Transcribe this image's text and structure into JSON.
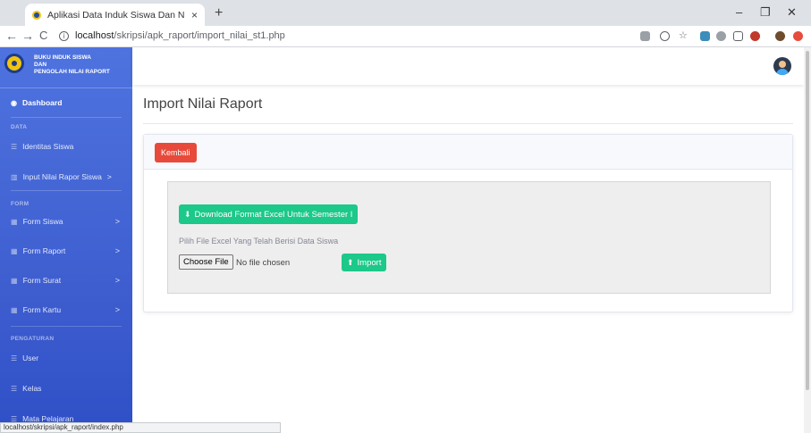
{
  "browser": {
    "tab_title": "Aplikasi Data Induk Siswa Dan N",
    "tab_close": "×",
    "new_tab": "+",
    "url_host": "localhost",
    "url_path": "/skripsi/apk_raport/import_nilai_st1.php",
    "status_url": "localhost/skripsi/apk_raport/index.php",
    "controls": {
      "minimize": "–",
      "maximize": "❐",
      "close": "✕"
    }
  },
  "sidebar": {
    "brand_lines": [
      "BUKU INDUK SISWA",
      "DAN",
      "PENGOLAH NILAI RAPORT"
    ],
    "dashboard": "Dashboard",
    "sections": {
      "data": "DATA",
      "form": "FORM",
      "settings": "PENGATURAN"
    },
    "items": [
      {
        "label": "Identitas Siswa",
        "has_arrow": false
      },
      {
        "label": "Input Nilai Rapor Siswa",
        "has_arrow": true
      },
      {
        "label": "Form Siswa",
        "has_arrow": true
      },
      {
        "label": "Form Raport",
        "has_arrow": true
      },
      {
        "label": "Form Surat",
        "has_arrow": true
      },
      {
        "label": "Form Kartu",
        "has_arrow": true
      },
      {
        "label": "User",
        "has_arrow": false
      },
      {
        "label": "Kelas",
        "has_arrow": false
      },
      {
        "label": "Mata Pelajaran",
        "has_arrow": false
      }
    ],
    "arrow_glyph": ">"
  },
  "main": {
    "page_title": "Import Nilai Raport",
    "back_button": "Kembali",
    "download_button": "Download Format Excel Untuk Semester I",
    "file_label": "Pilih File Excel Yang Telah Berisi Data Siswa",
    "choose_file": "Choose File",
    "file_status": "No file chosen",
    "import_button": "Import"
  },
  "colors": {
    "sidebar": "#4e73df",
    "danger": "#e74a3b",
    "success": "#1cc88a"
  }
}
